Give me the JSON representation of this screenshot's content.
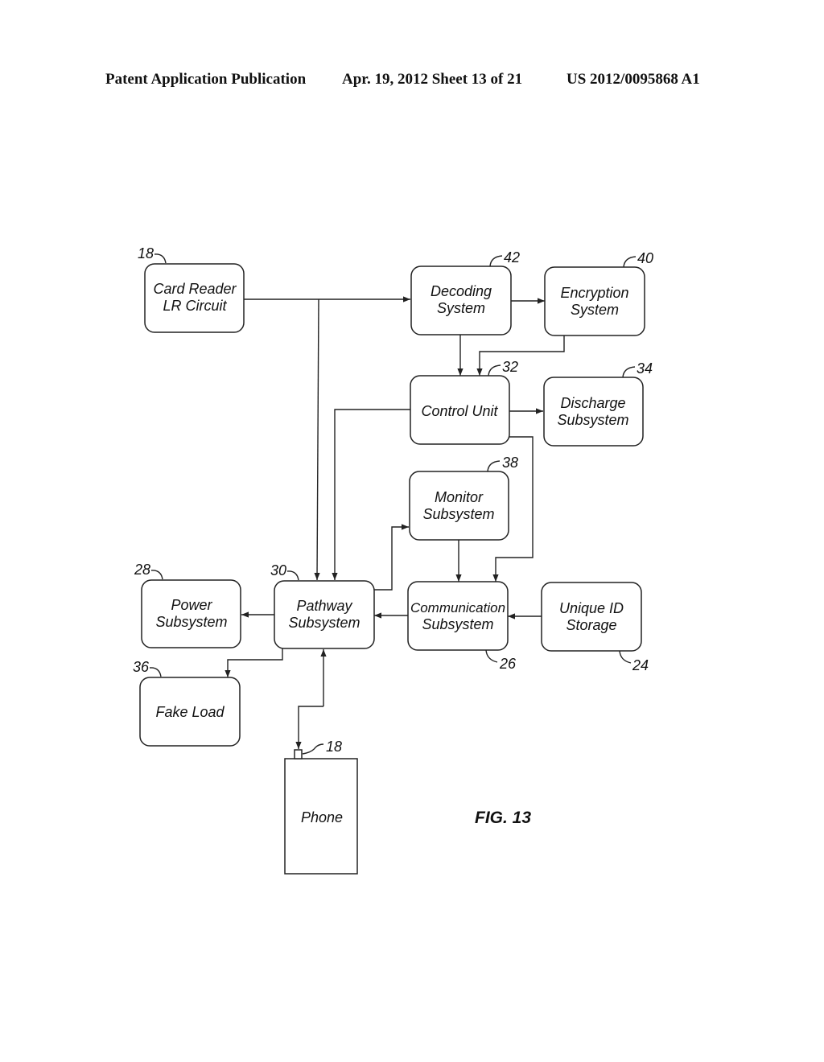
{
  "header": {
    "left": "Patent Application Publication",
    "center": "Apr. 19, 2012  Sheet 13 of 21",
    "right": "US 2012/0095868 A1"
  },
  "figure_label": "FIG. 13",
  "blocks": {
    "card_reader": {
      "line1": "Card Reader",
      "line2": "LR Circuit",
      "ref": "18"
    },
    "decoding": {
      "line1": "Decoding",
      "line2": "System",
      "ref": "42"
    },
    "encryption": {
      "line1": "Encryption",
      "line2": "System",
      "ref": "40"
    },
    "control": {
      "line1": "Control Unit",
      "ref": "32"
    },
    "discharge": {
      "line1": "Discharge",
      "line2": "Subsystem",
      "ref": "34"
    },
    "monitor": {
      "line1": "Monitor",
      "line2": "Subsystem",
      "ref": "38"
    },
    "power": {
      "line1": "Power",
      "line2": "Subsystem",
      "ref": "28"
    },
    "pathway": {
      "line1": "Pathway",
      "line2": "Subsystem",
      "ref": "30"
    },
    "communication": {
      "line1": "Communication",
      "line2": "Subsystem",
      "ref": "26"
    },
    "unique_id": {
      "line1": "Unique ID",
      "line2": "Storage",
      "ref": "24"
    },
    "fake_load": {
      "line1": "Fake Load",
      "ref": "36"
    },
    "phone": {
      "line1": "Phone",
      "connector_ref": "18"
    }
  }
}
